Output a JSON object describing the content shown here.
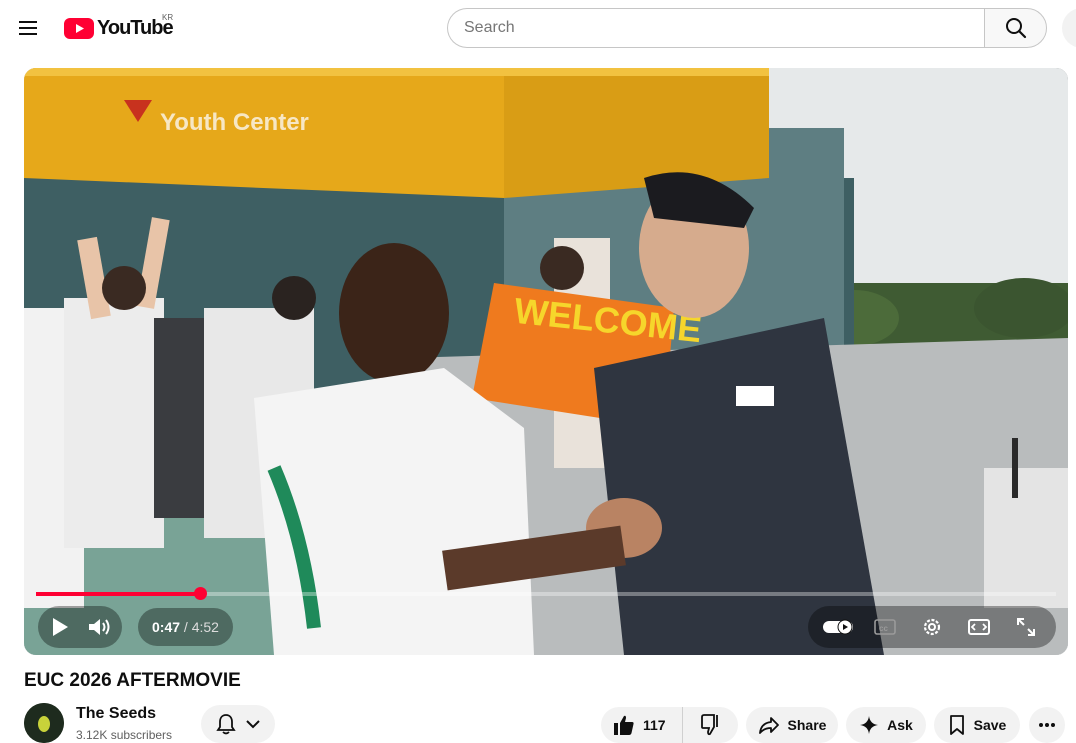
{
  "header": {
    "logo_text": "YouTube",
    "region": "KR",
    "search_placeholder": "Search"
  },
  "player": {
    "scene_sign_text": "Youth Center",
    "scene_banner_text": "WELCOME",
    "current_time": "0:47",
    "separator": " / ",
    "duration": "4:52",
    "progress_fraction": 0.161,
    "accent_color": "#ff0033"
  },
  "video": {
    "title": "EUC 2026 AFTERMOVIE"
  },
  "channel": {
    "name": "The Seeds",
    "subscribers": "3.12K subscribers"
  },
  "actions": {
    "like_count": "117",
    "share_label": "Share",
    "ask_label": "Ask",
    "save_label": "Save"
  },
  "icons": [
    "menu-icon",
    "youtube-logo-icon",
    "search-icon",
    "play-icon",
    "volume-icon",
    "autoplay-toggle-icon",
    "captions-icon",
    "settings-icon",
    "theater-icon",
    "fullscreen-icon",
    "bell-icon",
    "chevron-down-icon",
    "like-icon",
    "dislike-icon",
    "share-icon",
    "sparkle-icon",
    "bookmark-icon",
    "more-icon"
  ]
}
